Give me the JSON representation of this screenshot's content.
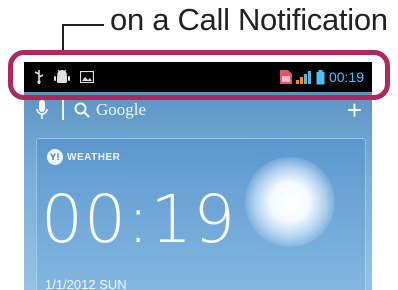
{
  "callout": {
    "label": "on a Call Notification"
  },
  "statusbar": {
    "left_icons": [
      "usb-icon",
      "android-debug-icon",
      "image-icon"
    ],
    "right_icons": [
      "sim-icon",
      "signal-icon",
      "battery-icon"
    ],
    "time": "00:19",
    "time_color": "#4cc3f5",
    "highlight_color": "#b0265e"
  },
  "search": {
    "label": "Google"
  },
  "widget": {
    "brand": "WEATHER",
    "time": "00:19",
    "date": "1/1/2012 SUN"
  }
}
